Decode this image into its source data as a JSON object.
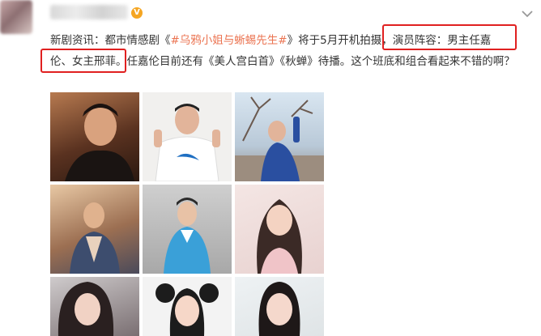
{
  "post": {
    "text_prefix": "新剧资讯：都市情感剧《",
    "topic": "#乌鸦小姐与蜥蜴先生#",
    "text_mid": "》将于5月开机拍摄，",
    "cast_label": "演员阵容：男主任嘉",
    "cast_line2": "伦、女主邢菲。",
    "text_rest": "任嘉伦目前还有《美人宫白首》《秋蝉》待播。这个班底和组合看起来不错的啊？"
  },
  "icons": [
    "v-badge-icon",
    "chevron-down-icon"
  ],
  "colors": {
    "topic": "#eb7350",
    "highlight_box": "#e02020",
    "verified_badge": "#f5a623"
  }
}
